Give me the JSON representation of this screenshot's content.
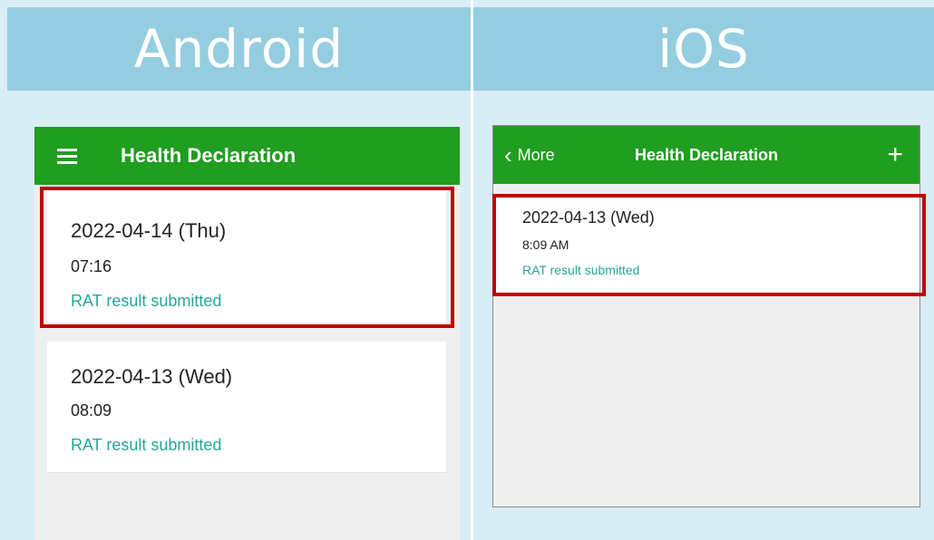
{
  "colors": {
    "header_bg": "#95cde0",
    "panel_bg": "#d9edf6",
    "appbar_green": "#1f9e1f",
    "status_teal": "#26a69a",
    "highlight_red": "#c00000"
  },
  "android": {
    "header": "Android",
    "app_title": "Health Declaration",
    "menu_icon": "hamburger-menu-icon",
    "records": [
      {
        "date": "2022-04-14 (Thu)",
        "time": "07:16",
        "status": "RAT result submitted"
      },
      {
        "date": "2022-04-13 (Wed)",
        "time": "08:09",
        "status": "RAT result submitted"
      }
    ]
  },
  "ios": {
    "header": "iOS",
    "back_label": "More",
    "back_icon": "chevron-left-icon",
    "app_title": "Health Declaration",
    "add_icon": "+",
    "records": [
      {
        "date": "2022-04-13 (Wed)",
        "time": "8:09 AM",
        "status": "RAT result submitted"
      }
    ]
  }
}
